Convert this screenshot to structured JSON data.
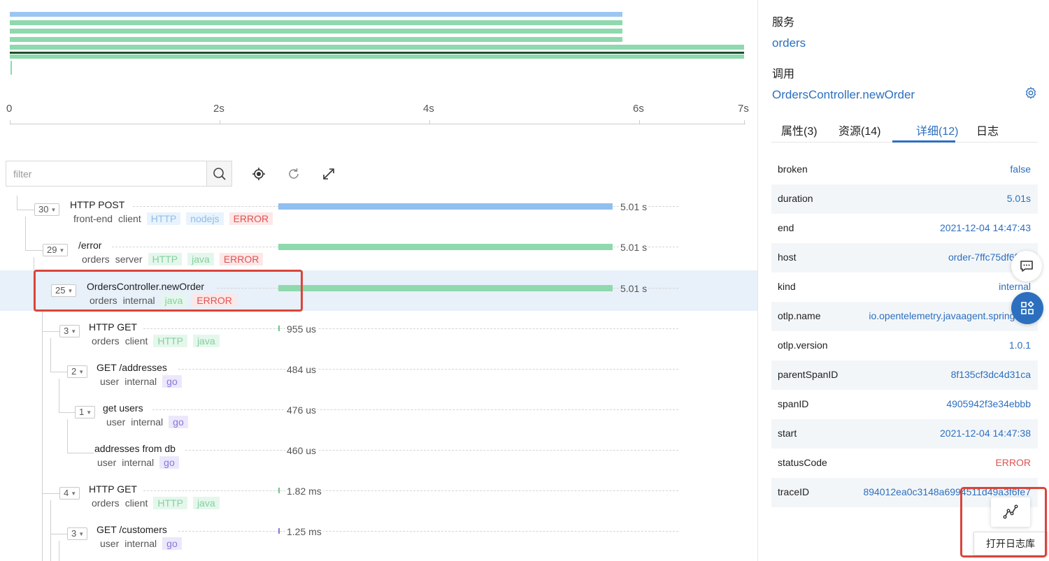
{
  "timeline": {
    "ticks": [
      "0",
      "2s",
      "4s",
      "6s",
      "7s"
    ]
  },
  "toolbar": {
    "filter_placeholder": "filter"
  },
  "spans": [
    {
      "count": "30",
      "name": "HTTP POST",
      "service": "front-end",
      "kind": "client",
      "tags": [
        "HTTP",
        "nodejs",
        "ERROR"
      ],
      "duration": "5.01 s"
    },
    {
      "count": "29",
      "name": "/error",
      "service": "orders",
      "kind": "server",
      "tags": [
        "HTTP",
        "java",
        "ERROR"
      ],
      "duration": "5.01 s"
    },
    {
      "count": "25",
      "name": "OrdersController.newOrder",
      "service": "orders",
      "kind": "internal",
      "tags": [
        "java",
        "ERROR"
      ],
      "duration": "5.01 s"
    },
    {
      "count": "3",
      "name": "HTTP GET",
      "service": "orders",
      "kind": "client",
      "tags": [
        "HTTP",
        "java"
      ],
      "duration": "955 us"
    },
    {
      "count": "2",
      "name": "GET /addresses",
      "service": "user",
      "kind": "internal",
      "tags": [
        "go"
      ],
      "duration": "484 us"
    },
    {
      "count": "1",
      "name": "get users",
      "service": "user",
      "kind": "internal",
      "tags": [
        "go"
      ],
      "duration": "476 us"
    },
    {
      "count": "",
      "name": "addresses from db",
      "service": "user",
      "kind": "internal",
      "tags": [
        "go"
      ],
      "duration": "460 us"
    },
    {
      "count": "4",
      "name": "HTTP GET",
      "service": "orders",
      "kind": "client",
      "tags": [
        "HTTP",
        "java"
      ],
      "duration": "1.82 ms"
    },
    {
      "count": "3",
      "name": "GET /customers",
      "service": "user",
      "kind": "internal",
      "tags": [
        "go"
      ],
      "duration": "1.25 ms"
    }
  ],
  "detail": {
    "service_label": "服务",
    "service_value": "orders",
    "call_label": "调用",
    "call_value": "OrdersController.newOrder",
    "tabs": [
      "属性(3)",
      "资源(14)",
      "详细(12)",
      "日志"
    ],
    "active_tab": "详细(12)",
    "rows": [
      {
        "key": "broken",
        "value": "false"
      },
      {
        "key": "duration",
        "value": "5.01s"
      },
      {
        "key": "end",
        "value": "2021-12-04 14:47:43"
      },
      {
        "key": "host",
        "value": "order-7ffc75df6f-6k"
      },
      {
        "key": "kind",
        "value": "internal"
      },
      {
        "key": "otlp.name",
        "value": "io.opentelemetry.javaagent.spring-we"
      },
      {
        "key": "otlp.version",
        "value": "1.0.1"
      },
      {
        "key": "parentSpanID",
        "value": "8f135cf3dc4d31ca"
      },
      {
        "key": "spanID",
        "value": "4905942f3e34ebbb"
      },
      {
        "key": "start",
        "value": "2021-12-04 14:47:38"
      },
      {
        "key": "statusCode",
        "value": "ERROR"
      },
      {
        "key": "traceID",
        "value": "894012ea0c3148a6994511d49a3f6fe7"
      }
    ],
    "open_log_tooltip": "打开日志库"
  },
  "colors": {
    "accent": "#2c6fbf",
    "error": "#e05252",
    "bar_blue": "#90bff0",
    "bar_green": "#8ed9ad",
    "highlight": "#d9453b"
  }
}
